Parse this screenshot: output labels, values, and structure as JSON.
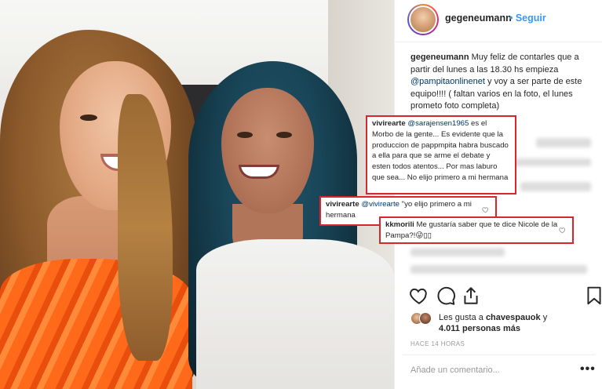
{
  "post": {
    "username": "gegeneumann",
    "follow_label": "• Seguir",
    "caption": {
      "username": "gegeneumann",
      "text_1": "Muy feliz de contarles que a partir del lunes a las 18.30 hs empieza ",
      "mention": "@pampitaonlinenet",
      "text_2": " y voy a ser parte de este equipo!!!! ( faltan varios en la foto, el lunes prometo foto completa)"
    }
  },
  "comments": [
    {
      "username": "vivirearte",
      "mention": "@sarajensen1965",
      "text": " es el Morbo de la gente... Es evidente que la produccion de pappmpita habra buscado a ella para que se arme el debate y esten todos atentos... Por mas laburo que sea... No elijo primero a mi hermana"
    },
    {
      "username": "vivirearte",
      "mention": "@vivirearte",
      "text": " \"yo elijo primero a mi hermana"
    },
    {
      "username": "kkmorili",
      "text": " Me gustaría saber que te dice Nicole de la Pampa?!😜▯▯"
    }
  ],
  "likes": {
    "line1_prefix": "Les gusta a ",
    "line1_user": "chavespauok",
    "line1_suffix": " y",
    "line2_count": "4.011",
    "line2_suffix": " personas más"
  },
  "time_ago": "HACE 14 HORAS",
  "add_comment_placeholder": "Añade un comentario...",
  "more_label": "•••",
  "icons": [
    "heart-icon",
    "comment-icon",
    "share-icon",
    "bookmark-icon"
  ],
  "colors": {
    "link": "#3897f0",
    "highlight_border": "#d9262c",
    "mention": "#003569"
  }
}
